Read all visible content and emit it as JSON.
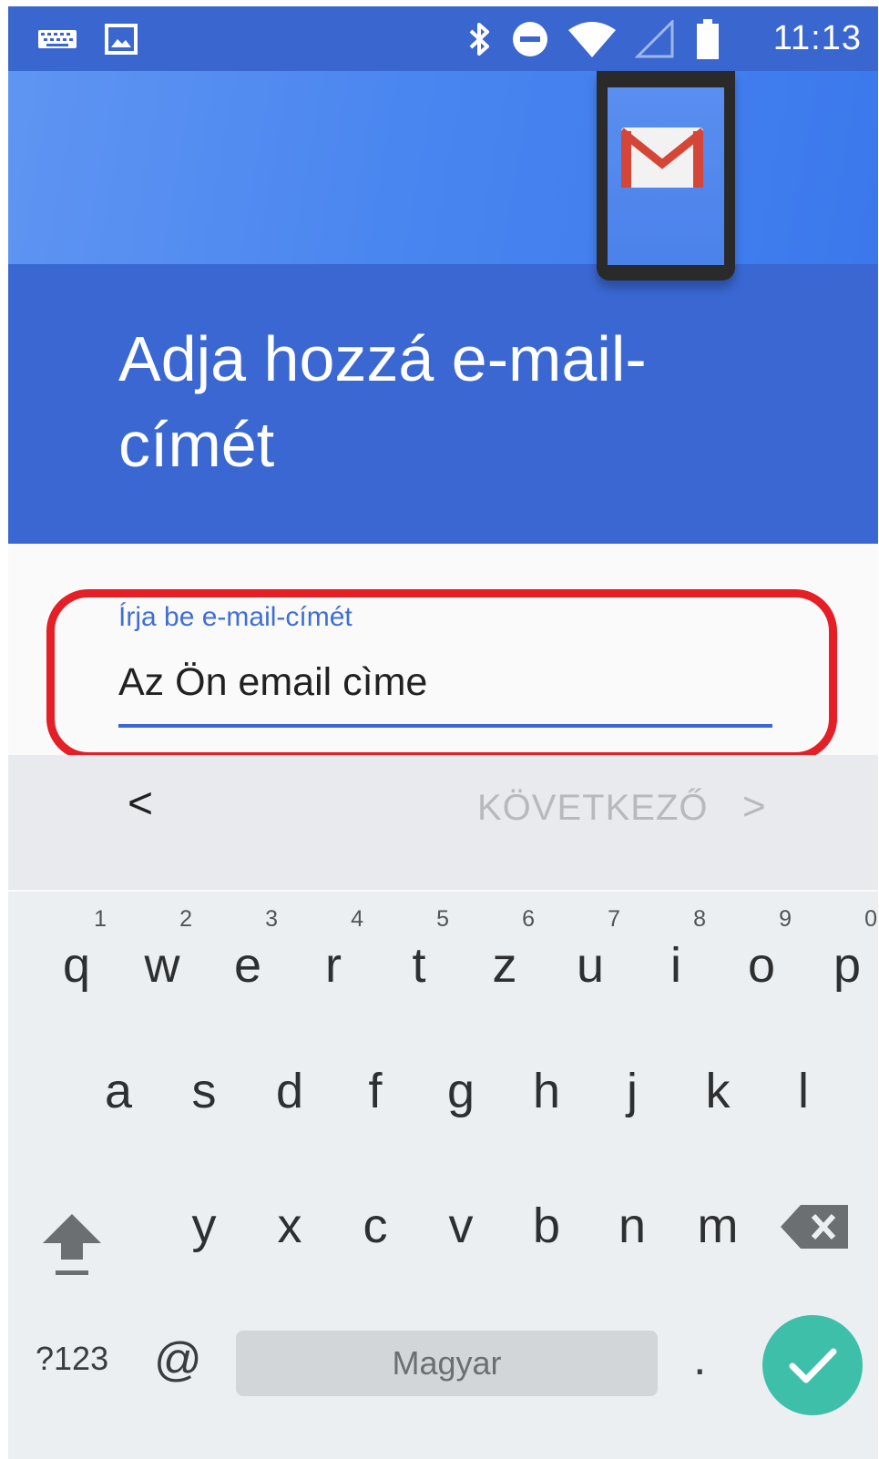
{
  "status_bar": {
    "time": "11:13",
    "icons": [
      "keyboard-icon",
      "image-icon",
      "bluetooth-icon",
      "do-not-disturb-icon",
      "wifi-icon",
      "signal-icon",
      "battery-icon"
    ]
  },
  "header": {
    "title_line1": "Adja hozzá e-mail-",
    "title_line2": "címét",
    "illustration": "gmail-phone-illustration"
  },
  "email_field": {
    "label": "Írja be e-mail-címét",
    "value": "Az Ön email cìme"
  },
  "nav": {
    "back_symbol": "<",
    "next_label": "KÖVETKEZŐ",
    "next_symbol": ">"
  },
  "keyboard": {
    "row1": [
      {
        "num": "1",
        "ch": "q"
      },
      {
        "num": "2",
        "ch": "w"
      },
      {
        "num": "3",
        "ch": "e"
      },
      {
        "num": "4",
        "ch": "r"
      },
      {
        "num": "5",
        "ch": "t"
      },
      {
        "num": "6",
        "ch": "z"
      },
      {
        "num": "7",
        "ch": "u"
      },
      {
        "num": "8",
        "ch": "i"
      },
      {
        "num": "9",
        "ch": "o"
      },
      {
        "num": "0",
        "ch": "p"
      }
    ],
    "row2": [
      "a",
      "s",
      "d",
      "f",
      "g",
      "h",
      "j",
      "k",
      "l"
    ],
    "row3": [
      "y",
      "x",
      "c",
      "v",
      "b",
      "n",
      "m"
    ],
    "symbols_label": "?123",
    "at_label": "@",
    "space_label": "Magyar",
    "period_label": ".",
    "enter_color": "#3ebfa9"
  },
  "colors": {
    "status_bar": "#3a66d0",
    "header": "#3a67d2",
    "highlight": "#e41f26",
    "accent": "#3b68d4"
  }
}
